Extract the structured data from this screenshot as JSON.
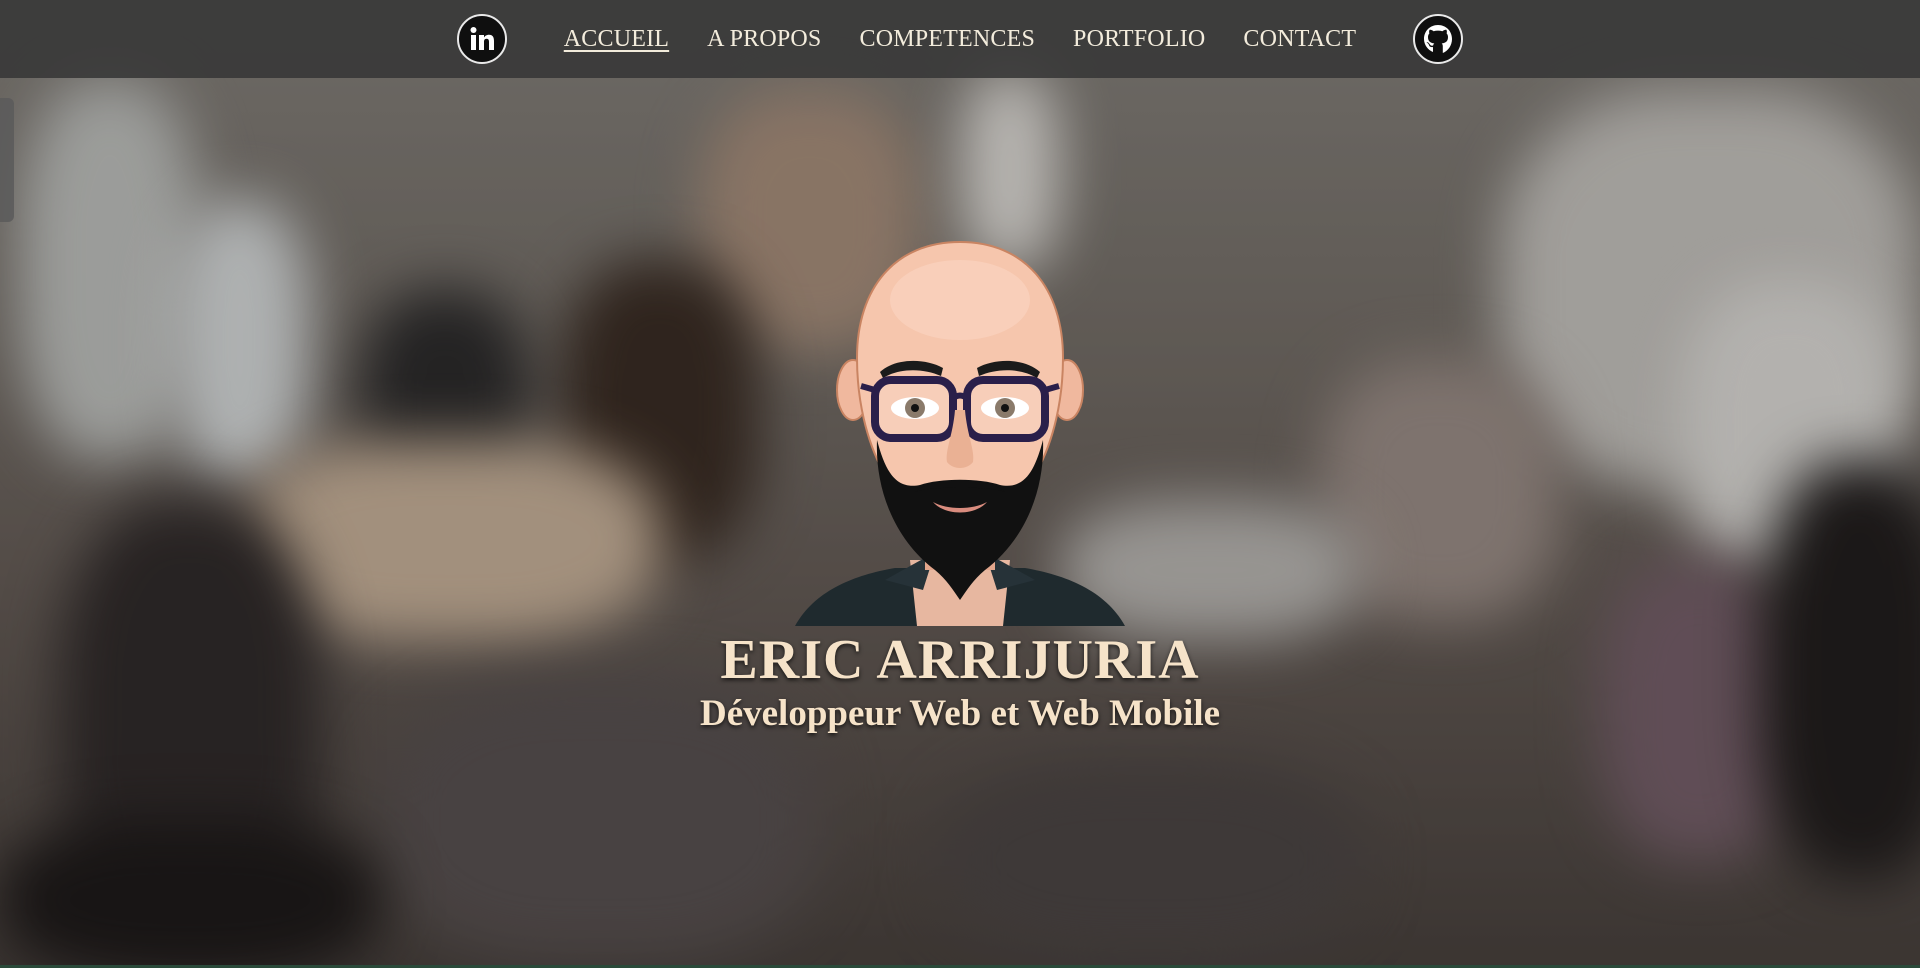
{
  "nav": {
    "linkedin_icon": "linkedin-icon",
    "github_icon": "github-icon",
    "items": [
      {
        "label": "ACCUEIL",
        "active": true
      },
      {
        "label": "A PROPOS"
      },
      {
        "label": "COMPETENCES"
      },
      {
        "label": "PORTFOLIO"
      },
      {
        "label": "CONTACT"
      }
    ]
  },
  "hero": {
    "name": "ERIC ARRIJURIA",
    "role": "Développeur Web et Web Mobile"
  },
  "colors": {
    "nav_bg": "#373737",
    "text_cream": "#f6e3c9",
    "nav_text": "#f3ecdc"
  }
}
